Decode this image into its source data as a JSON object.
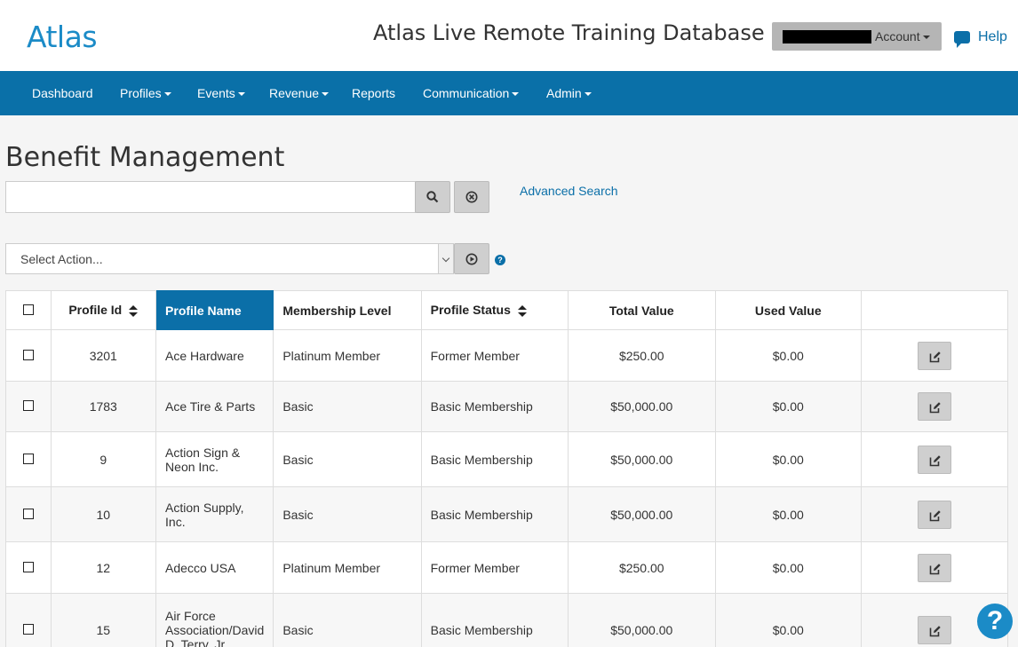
{
  "header": {
    "logo": "Atlas",
    "app_title": "Atlas Live Remote Training Database",
    "account_label": "Account",
    "help_label": "Help"
  },
  "nav": {
    "items": [
      {
        "label": "Dashboard"
      },
      {
        "label": "Profiles"
      },
      {
        "label": "Events"
      },
      {
        "label": "Revenue"
      },
      {
        "label": "Reports"
      },
      {
        "label": "Communication"
      },
      {
        "label": "Admin"
      }
    ]
  },
  "page": {
    "title": "Benefit Management",
    "search_value": "",
    "advanced_search": "Advanced Search",
    "action_select": "Select Action..."
  },
  "table": {
    "columns": [
      "Profile Id",
      "Profile Name",
      "Membership Level",
      "Profile Status",
      "Total Value",
      "Used Value",
      ""
    ],
    "rows": [
      {
        "id": "3201",
        "name": "Ace Hardware",
        "level": "Platinum Member",
        "status": "Former Member",
        "total": "$250.00",
        "used": "$0.00"
      },
      {
        "id": "1783",
        "name": "Ace Tire & Parts",
        "level": "Basic",
        "status": "Basic Membership",
        "total": "$50,000.00",
        "used": "$0.00"
      },
      {
        "id": "9",
        "name": "Action Sign & Neon Inc.",
        "level": "Basic",
        "status": "Basic Membership",
        "total": "$50,000.00",
        "used": "$0.00"
      },
      {
        "id": "10",
        "name": "Action Supply, Inc.",
        "level": "Basic",
        "status": "Basic Membership",
        "total": "$50,000.00",
        "used": "$0.00"
      },
      {
        "id": "12",
        "name": "Adecco USA",
        "level": "Platinum Member",
        "status": "Former Member",
        "total": "$250.00",
        "used": "$0.00"
      },
      {
        "id": "15",
        "name": "Air Force Association/David D. Terry, Jr.",
        "level": "Basic",
        "status": "Basic Membership",
        "total": "$50,000.00",
        "used": "$0.00"
      }
    ]
  },
  "colors": {
    "brand": "#1b8bc7",
    "nav_bg": "#0a70a8",
    "active_header": "#0b6fa8"
  },
  "icons": [
    "search-icon",
    "clear-icon",
    "run-icon",
    "info-icon",
    "edit-icon",
    "chat-icon",
    "help-float-icon"
  ]
}
